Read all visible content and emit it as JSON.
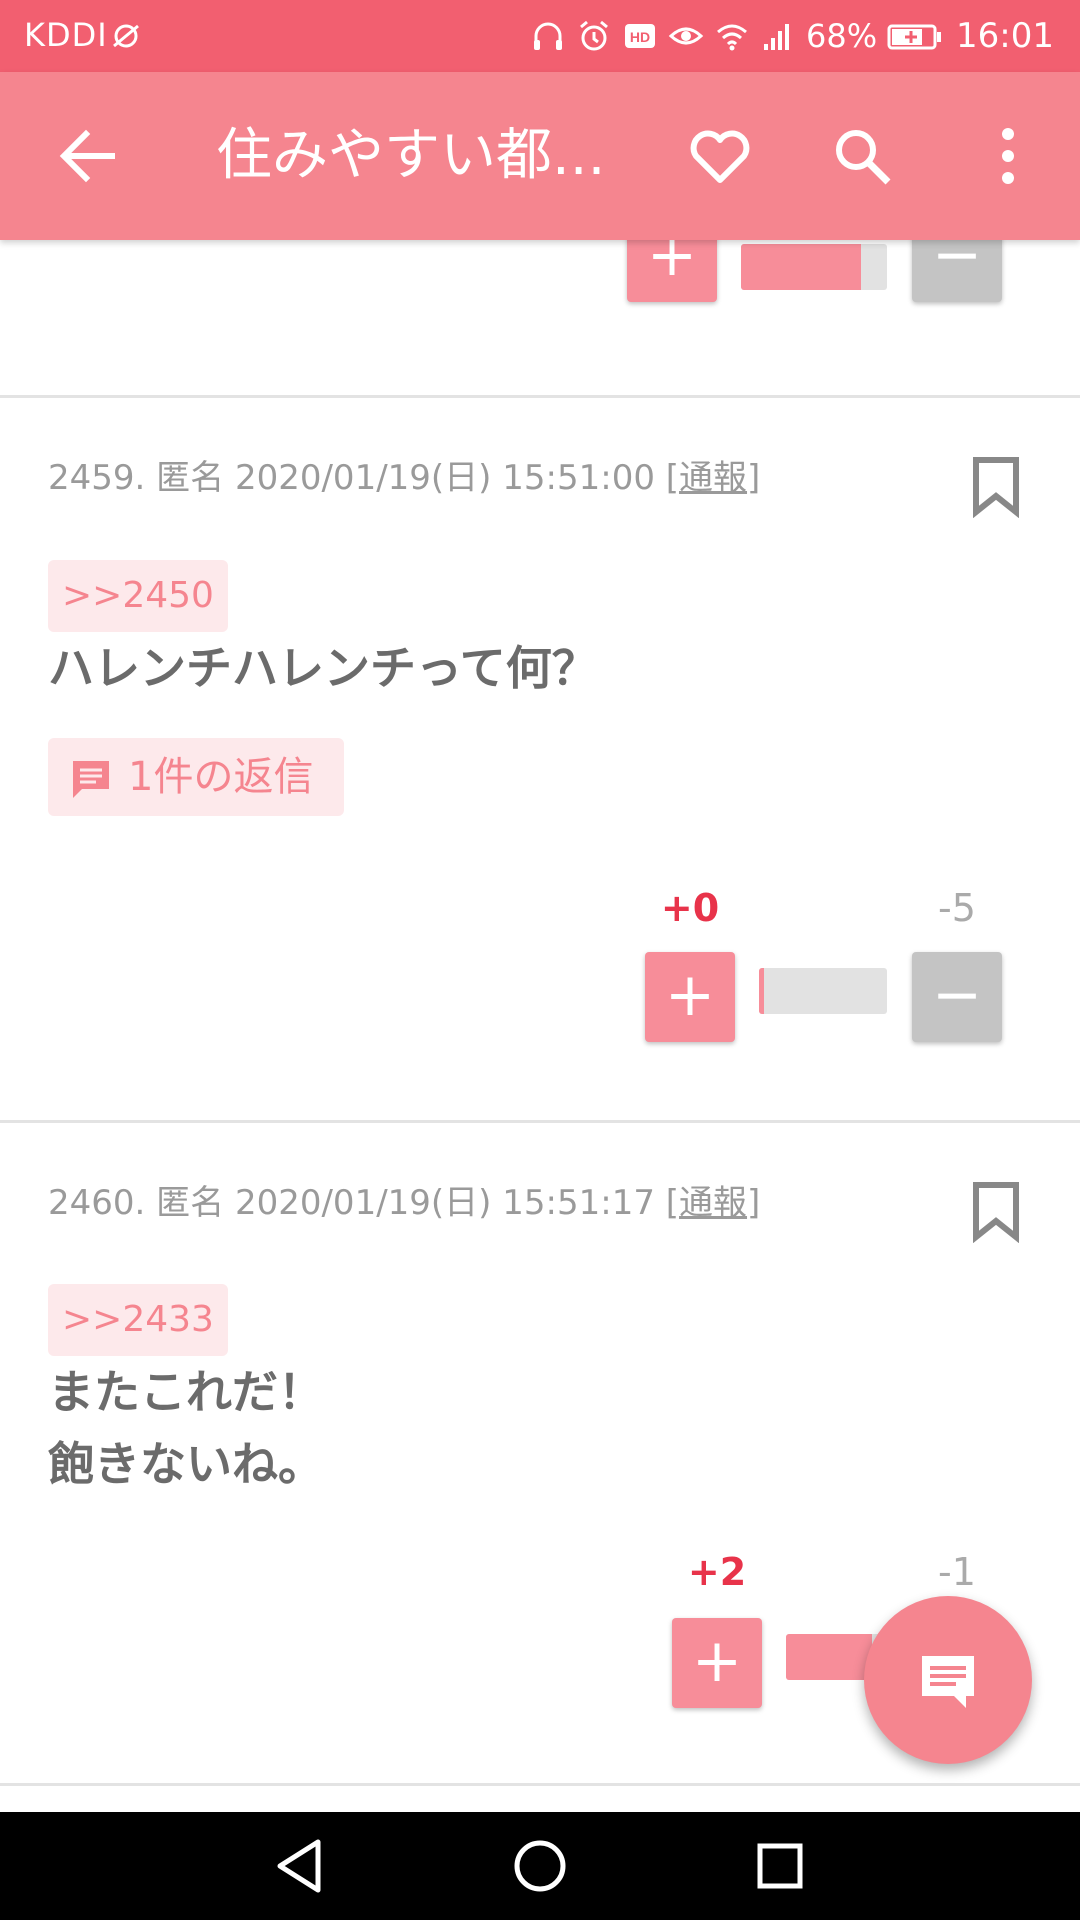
{
  "status_bar": {
    "carrier": "KDDI",
    "battery": "68%",
    "time": "16:01"
  },
  "toolbar": {
    "title": "住みやすい都..."
  },
  "previous_post": {},
  "posts": [
    {
      "meta_prefix": "2459. 匿名 2020/01/19(日) 15:51:00 [",
      "report": "通報",
      "meta_suffix": "]",
      "anchor": ">>2450",
      "body": [
        "ハレンチハレンチって何？"
      ],
      "replies": "1件の返信",
      "plus_count": "+0",
      "minus_count": "-5",
      "positive_share": 0.04
    },
    {
      "meta_prefix": "2460. 匿名 2020/01/19(日) 15:51:17 [",
      "report": "通報",
      "meta_suffix": "]",
      "anchor": ">>2433",
      "body": [
        "またこれだ！",
        "飽きないね。"
      ],
      "plus_count": "+2",
      "minus_count": "-1",
      "positive_share": 0.67
    }
  ],
  "previous_post_share": 0.82,
  "colors": {
    "status_bar": "#f25f70",
    "toolbar": "#f5858f",
    "accent": "#f78d99",
    "plus_count": "#e8334a"
  },
  "icons": {
    "back": "arrow-left-icon",
    "favorite": "heart-icon",
    "search": "search-icon",
    "more": "more-vertical-icon",
    "bookmark": "bookmark-icon",
    "reply": "comment-icon",
    "fab": "message-icon"
  }
}
